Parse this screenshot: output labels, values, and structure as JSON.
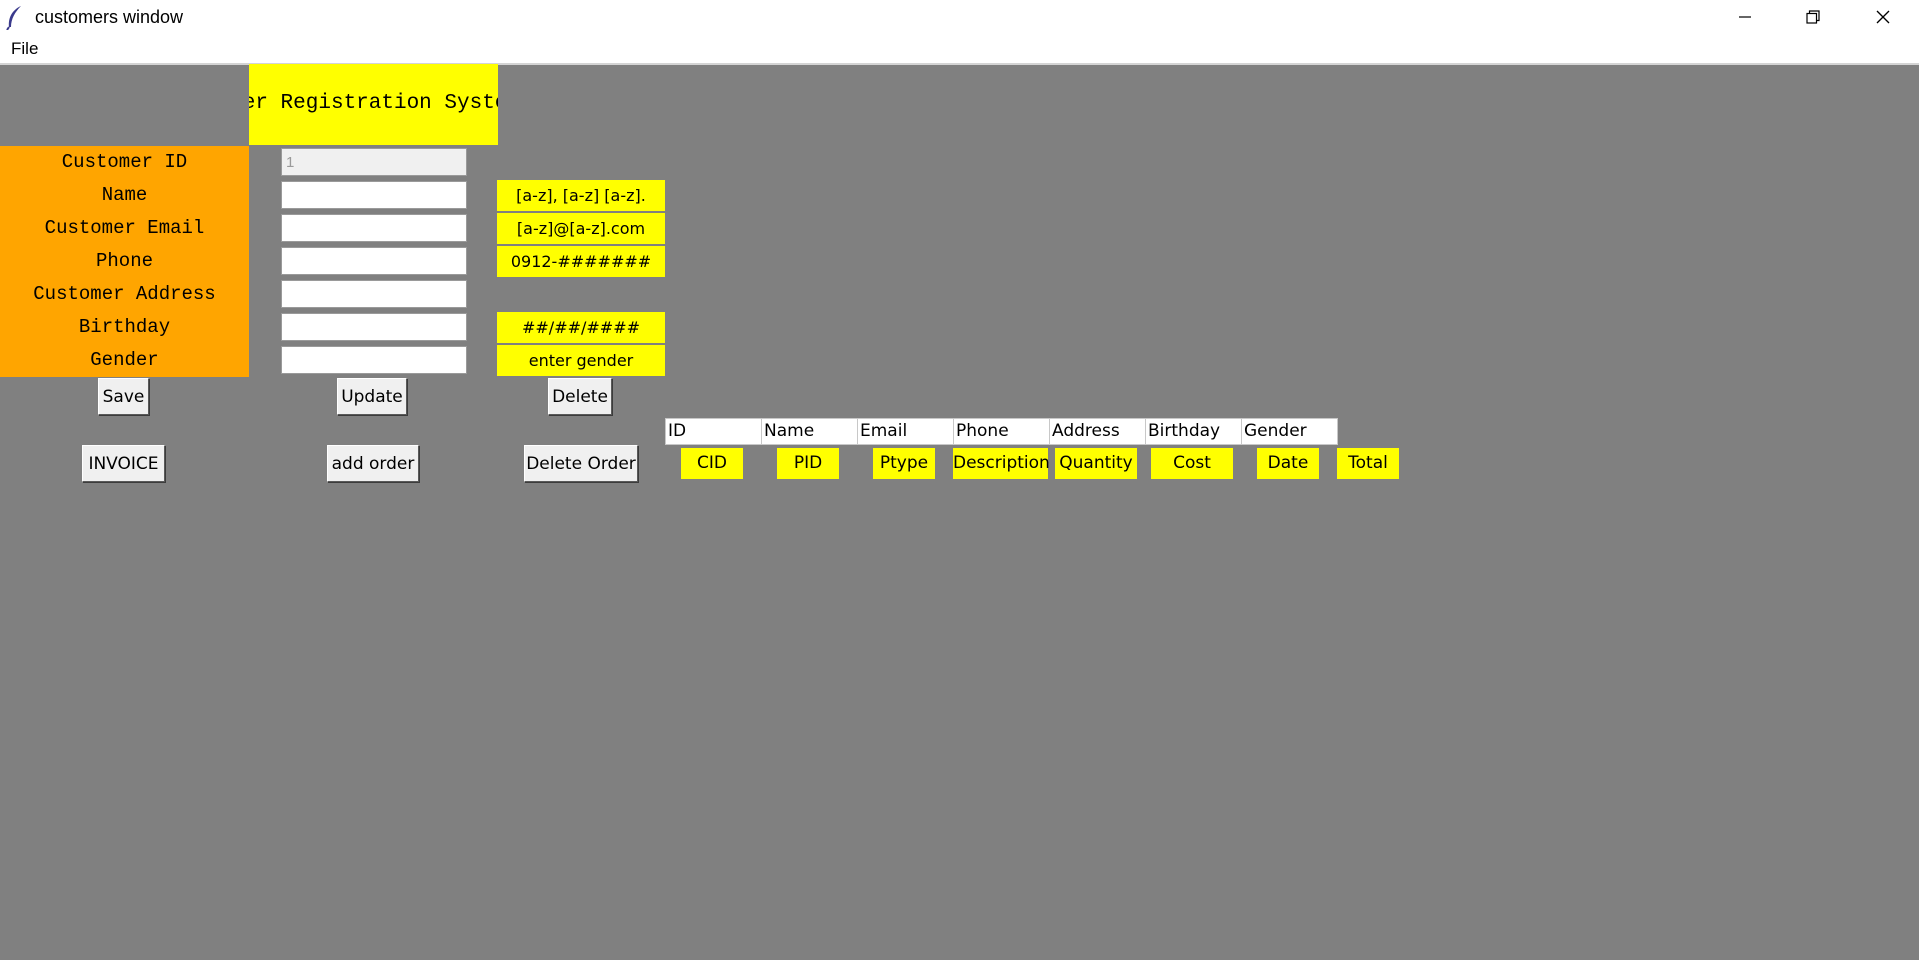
{
  "window": {
    "title": "customers window"
  },
  "menu": {
    "file": "File"
  },
  "header": {
    "title": "Customer Registration System"
  },
  "form": {
    "labels": [
      "Customer ID",
      "Name",
      "Customer Email",
      "Phone",
      "Customer Address",
      "Birthday",
      "Gender"
    ],
    "customer_id_value": "1",
    "hints": {
      "name": "[a-z], [a-z] [a-z].",
      "email": "[a-z]@[a-z].com",
      "phone": "0912-#######",
      "birthday": "##/##/####",
      "gender": "enter gender"
    }
  },
  "buttons": {
    "save": "Save",
    "update": "Update",
    "delete": "Delete",
    "invoice": "INVOICE",
    "add_order": "add order",
    "delete_order": "Delete Order"
  },
  "customer_columns": [
    "ID",
    "Name",
    "Email",
    "Phone",
    "Address",
    "Birthday",
    "Gender"
  ],
  "order_labels": [
    "CID",
    "PID",
    "Ptype",
    "Description",
    "Quantity",
    "Cost",
    "Date",
    "Total"
  ]
}
